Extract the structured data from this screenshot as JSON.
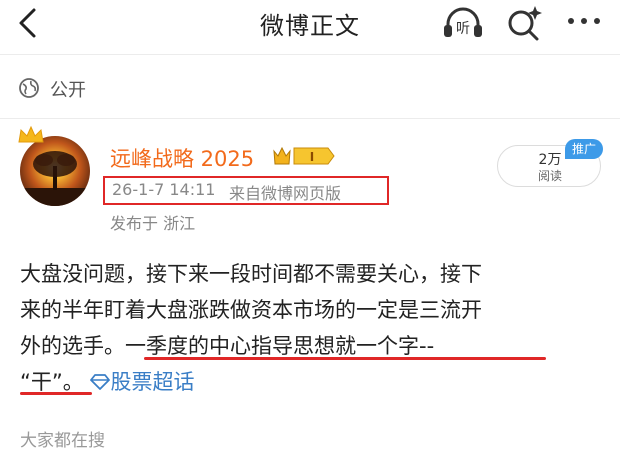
{
  "header": {
    "title": "微博正文",
    "listen_label": "听"
  },
  "visibility": {
    "label": "公开"
  },
  "author": {
    "name": "远峰战略 2025",
    "level_badge": "I",
    "post_time": "26-1-7 14:11",
    "source": "来自微博网页版",
    "location": "发布于 浙江"
  },
  "stats": {
    "read_count": "2万",
    "read_label": "阅读",
    "promo_badge": "推广"
  },
  "post": {
    "line1": "大盘没问题，接下来一段时间都不需要关心，接下",
    "line2": "来的半年盯着大盘涨跌做资本市场的一定是三流开",
    "line3_a": "外的选手。",
    "line3_b": "一季度的中心指导思想就一个字--",
    "line4_a": "“干”。",
    "topic_label": "股票超话"
  },
  "related": {
    "label": "大家都在搜"
  },
  "colors": {
    "accent_orange": "#f26a1b",
    "highlight_red": "#e02727",
    "topic_blue": "#3a7ec6",
    "promo_blue": "#3d9ae8"
  }
}
